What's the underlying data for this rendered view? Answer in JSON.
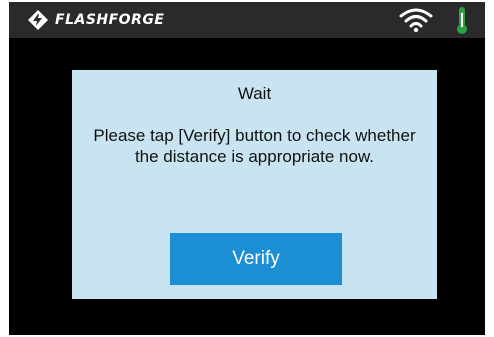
{
  "topbar": {
    "brand": "FLASHFORGE",
    "icons": {
      "logo": "flashforge-logo-icon",
      "wifi": "wifi-icon",
      "temperature": "thermometer-icon"
    },
    "colors": {
      "thermometer": "#2ea043"
    }
  },
  "dialog": {
    "title": "Wait",
    "message": "Please tap [Verify] button to check whether the distance is appropriate now.",
    "verify_label": "Verify",
    "colors": {
      "background": "#c9e4f1",
      "button": "#1c8ed3"
    }
  }
}
